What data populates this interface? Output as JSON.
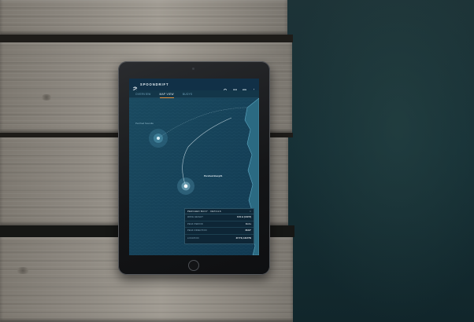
{
  "app": {
    "brand": "SPOONDRIFT",
    "logo_icon": "spoondrift-logo-icon",
    "toolbar_icons": [
      "search-icon",
      "grid-icon",
      "calendar-icon",
      "more-vertical-icon"
    ]
  },
  "tabs": [
    {
      "label": "OVERVIEW",
      "active": false
    },
    {
      "label": "MAP VIEW",
      "active": true
    },
    {
      "label": "BUOYS",
      "active": false
    }
  ],
  "map": {
    "markers": [
      {
        "label": "Perched Soundle"
      },
      {
        "label": "Perched Buoy01"
      }
    ]
  },
  "panel": {
    "title": "PERCHED BUOY · DETAILS",
    "close_icon": "close-icon",
    "rows": [
      {
        "key": "WAVE HEIGHT",
        "value": "0.31 m (1.02 ft)"
      },
      {
        "key": "PEAK PERIOD",
        "value": "11.4 s"
      },
      {
        "key": "PEAK DIRECTION",
        "value": "213.6°"
      },
      {
        "key": "LOCATION",
        "value": "37.5°N, 122.6°W"
      }
    ]
  },
  "colors": {
    "screen_bg": "#14394d",
    "accent_tab": "#e8913a",
    "marker": "#ffffff",
    "water_photo": "#163036"
  }
}
